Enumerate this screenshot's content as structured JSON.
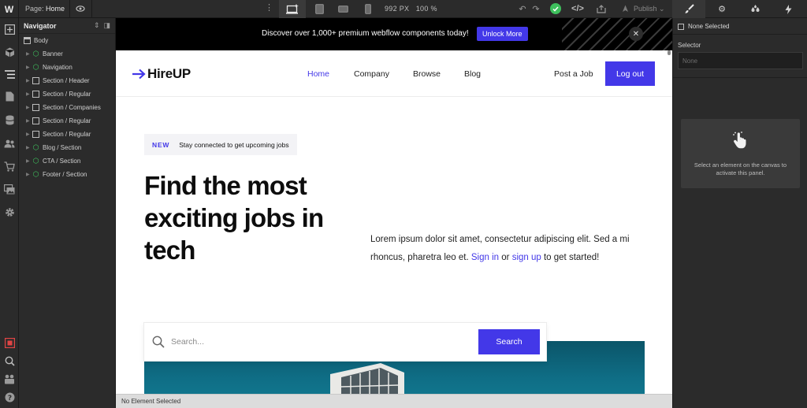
{
  "topbar": {
    "logo": "W",
    "page_label": "Page:",
    "page_name": "Home",
    "size_readout": "992 PX",
    "zoom": "100 %",
    "publish_label": "Publish"
  },
  "navigator": {
    "title": "Navigator",
    "items": [
      {
        "label": "Body",
        "kind": "body",
        "expandable": false,
        "indent": 0
      },
      {
        "label": "Banner",
        "kind": "symbol",
        "expandable": true,
        "indent": 1
      },
      {
        "label": "Navigation",
        "kind": "symbol",
        "expandable": true,
        "indent": 1
      },
      {
        "label": "Section / Header",
        "kind": "box",
        "expandable": true,
        "indent": 1
      },
      {
        "label": "Section / Regular",
        "kind": "box",
        "expandable": true,
        "indent": 1
      },
      {
        "label": "Section / Companies",
        "kind": "box",
        "expandable": true,
        "indent": 1
      },
      {
        "label": "Section / Regular",
        "kind": "box",
        "expandable": true,
        "indent": 1
      },
      {
        "label": "Section / Regular",
        "kind": "box",
        "expandable": true,
        "indent": 1
      },
      {
        "label": "Blog / Section",
        "kind": "symbol",
        "expandable": true,
        "indent": 1
      },
      {
        "label": "CTA / Section",
        "kind": "symbol",
        "expandable": true,
        "indent": 1
      },
      {
        "label": "Footer / Section",
        "kind": "symbol",
        "expandable": true,
        "indent": 1
      }
    ]
  },
  "canvas": {
    "banner": {
      "message": "Discover over 1,000+ premium webflow components today!",
      "button": "Unlock More",
      "close": "✕"
    },
    "header": {
      "brand": "HireUP",
      "links": [
        {
          "label": "Home",
          "active": true
        },
        {
          "label": "Company",
          "active": false
        },
        {
          "label": "Browse",
          "active": false
        },
        {
          "label": "Blog",
          "active": false
        }
      ],
      "post_job": "Post a Job",
      "logout": "Log out"
    },
    "hero": {
      "tag_badge": "NEW",
      "tag_text": "Stay connected to get upcoming jobs",
      "headline": "Find the most exciting jobs in tech",
      "lead_text": "Lorem ipsum dolor sit amet, consectetur adipiscing elit. Sed a mi rhoncus, pharetra leo et.",
      "lead_link1": "Sign in",
      "lead_or": "or",
      "lead_link2": "sign up",
      "lead_tail": "to get started!",
      "search_placeholder": "Search...",
      "search_button": "Search"
    },
    "status": "No Element Selected"
  },
  "right_panel": {
    "none_selected": "None Selected",
    "selector_label": "Selector",
    "selector_value": "None",
    "empty_message": "Select an element on the canvas to activate this panel."
  },
  "colors": {
    "accent": "#4338e8",
    "symbol_green": "#3ec05d",
    "editor_bg": "#2b2b2b"
  }
}
